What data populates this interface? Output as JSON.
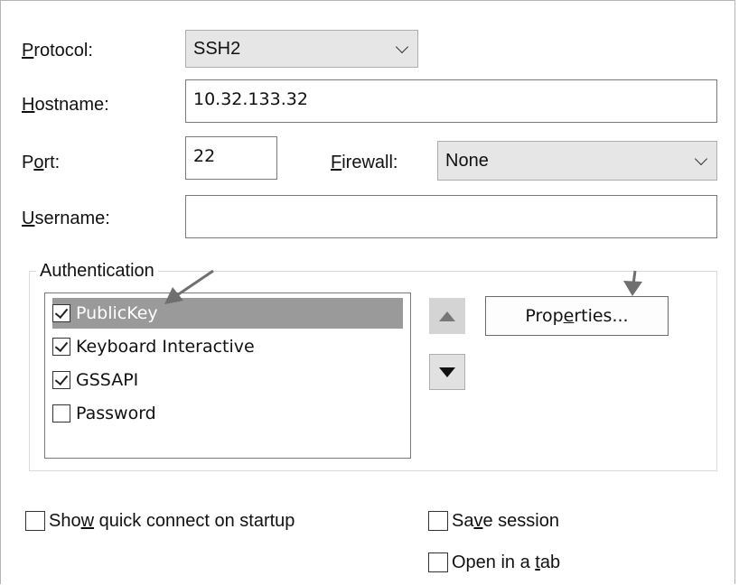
{
  "form": {
    "protocol": {
      "label_pre": "",
      "label_key": "P",
      "label_post": "rotocol:",
      "value": "SSH2"
    },
    "hostname": {
      "label_pre": "",
      "label_key": "H",
      "label_post": "ostname:",
      "value": "10.32.133.32"
    },
    "port": {
      "label_pre": "P",
      "label_key": "o",
      "label_post": "rt:",
      "value": "22"
    },
    "firewall": {
      "label_pre": "",
      "label_key": "F",
      "label_post": "irewall:",
      "value": "None"
    },
    "username": {
      "label_pre": "",
      "label_key": "U",
      "label_post": "sername:",
      "value": ""
    }
  },
  "authentication": {
    "title": "Authentication",
    "methods": [
      {
        "label": "PublicKey",
        "checked": true,
        "selected": true
      },
      {
        "label": "Keyboard Interactive",
        "checked": true,
        "selected": false
      },
      {
        "label": "GSSAPI",
        "checked": true,
        "selected": false
      },
      {
        "label": "Password",
        "checked": false,
        "selected": false
      }
    ],
    "properties_button": {
      "pre": "Prop",
      "key": "e",
      "post": "rties..."
    }
  },
  "options": {
    "quick_connect": {
      "pre": "Sho",
      "key": "w",
      "post": " quick connect on startup",
      "checked": false
    },
    "save_session": {
      "pre": "Sa",
      "key": "v",
      "post": "e session",
      "checked": false
    },
    "open_in_tab": {
      "pre": "Open in a ",
      "key": "t",
      "post": "ab",
      "checked": false
    }
  },
  "colors": {
    "selected_row": "#9a9a9a",
    "annotation_arrow": "#6f6f6f"
  }
}
